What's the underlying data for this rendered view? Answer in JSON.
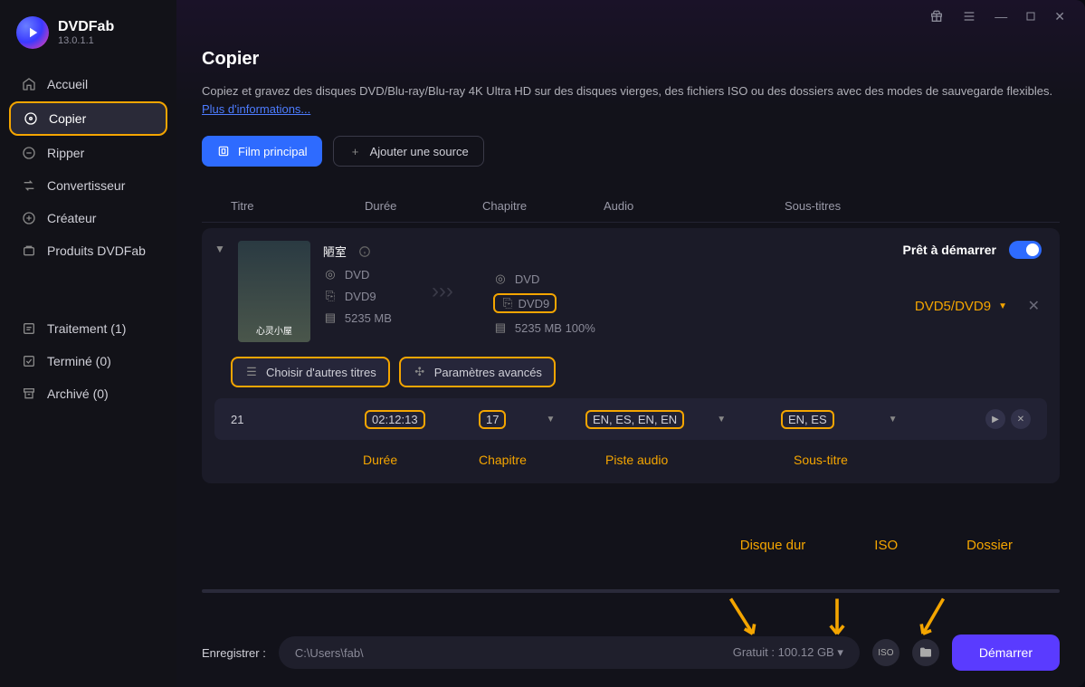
{
  "brand": {
    "name": "DVDFab",
    "version": "13.0.1.1"
  },
  "sidebar": {
    "items": [
      {
        "label": "Accueil"
      },
      {
        "label": "Copier"
      },
      {
        "label": "Ripper"
      },
      {
        "label": "Convertisseur"
      },
      {
        "label": "Créateur"
      },
      {
        "label": "Produits DVDFab"
      }
    ],
    "status": [
      {
        "label": "Traitement (1)"
      },
      {
        "label": "Terminé (0)"
      },
      {
        "label": "Archivé (0)"
      }
    ]
  },
  "page": {
    "title": "Copier",
    "desc": "Copiez et gravez des disques DVD/Blu-ray/Blu-ray 4K Ultra HD sur des disques vierges, des fichiers ISO ou des dossiers avec des modes de sauvegarde flexibles. ",
    "more": "Plus d'informations..."
  },
  "actions": {
    "main_movie": "Film principal",
    "add_source": "Ajouter une source"
  },
  "columns": {
    "title": "Titre",
    "duration": "Durée",
    "chapter": "Chapitre",
    "audio": "Audio",
    "subtitle": "Sous-titres"
  },
  "item": {
    "title": "陋室",
    "src_format": "DVD",
    "src_disc": "DVD9",
    "src_size": "5235 MB",
    "dst_format": "DVD",
    "dst_disc": "DVD9",
    "dst_info": "5235 MB 100%",
    "dvd_select": "DVD5/DVD9",
    "ready": "Prêt à démarrer",
    "choose_titles": "Choisir d'autres titres",
    "adv_params": "Paramètres avancés",
    "row_title": "21",
    "row_duration": "02:12:13",
    "row_chapter": "17",
    "row_audio": "EN, ES, EN, EN",
    "row_sub": "EN, ES"
  },
  "annot": {
    "duration": "Durée",
    "chapter": "Chapitre",
    "audio": "Piste audio",
    "subtitle": "Sous-titre",
    "hdd": "Disque dur",
    "iso": "ISO",
    "folder": "Dossier"
  },
  "footer": {
    "save_label": "Enregistrer :",
    "path": "C:\\Users\\fab\\",
    "free": "Gratuit : 100.12 GB",
    "start": "Démarrer"
  }
}
